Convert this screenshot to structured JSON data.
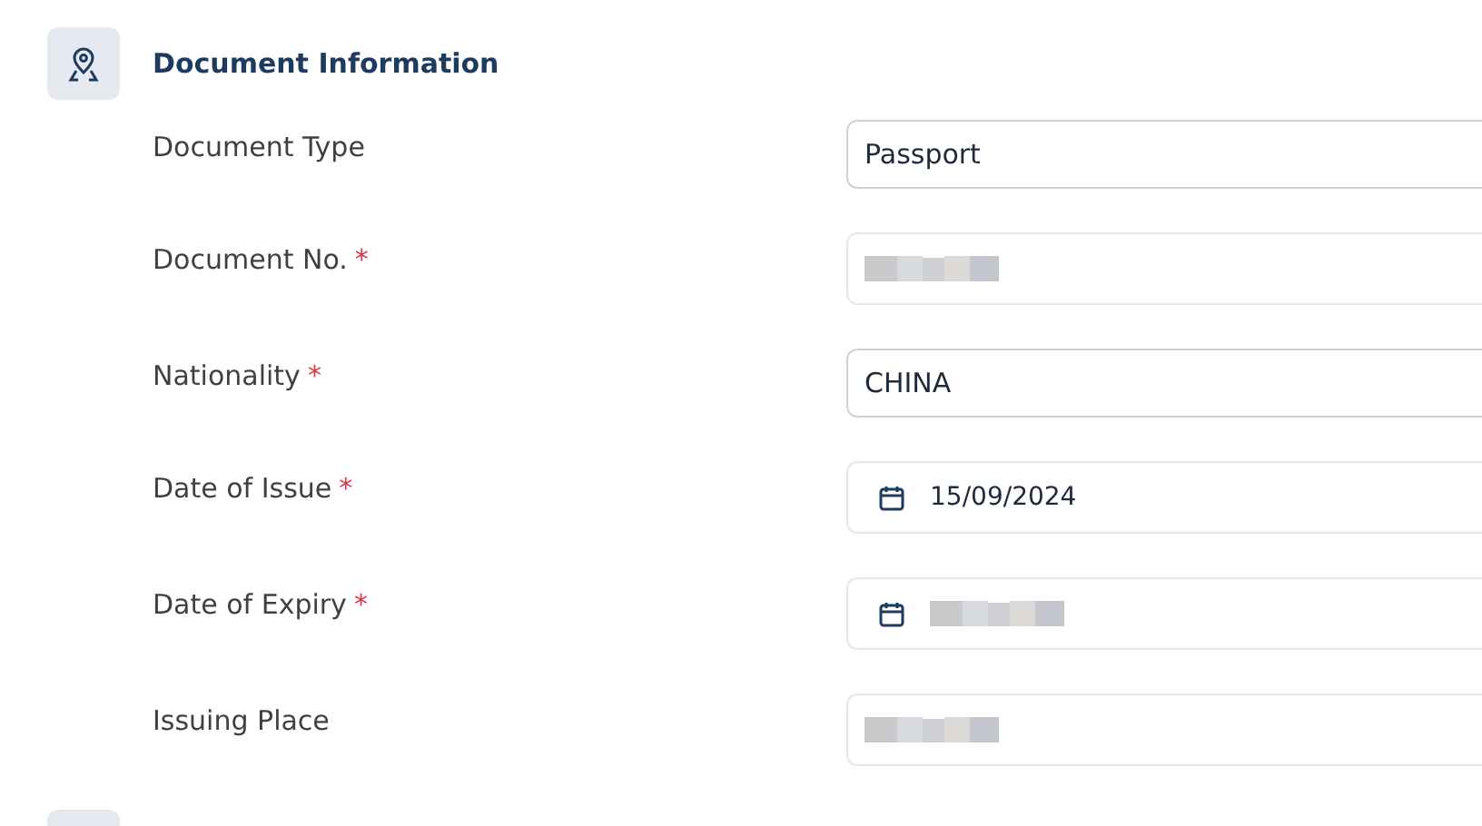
{
  "section": {
    "title": "Document Information"
  },
  "fields": [
    {
      "label": "Document Type",
      "kind": "select",
      "value": "Passport"
    },
    {
      "label": "Document No.",
      "required_mark": "*",
      "kind": "text",
      "redacted": true
    },
    {
      "label": "Nationality",
      "required_mark": "*",
      "kind": "select",
      "value": "CHINA"
    },
    {
      "label": "Date of Issue",
      "required_mark": "*",
      "kind": "date",
      "value": "15/09/2024"
    },
    {
      "label": "Date of Expiry",
      "required_mark": "*",
      "kind": "date",
      "redacted": true
    },
    {
      "label": "Issuing Place",
      "kind": "text",
      "redacted": true
    }
  ]
}
